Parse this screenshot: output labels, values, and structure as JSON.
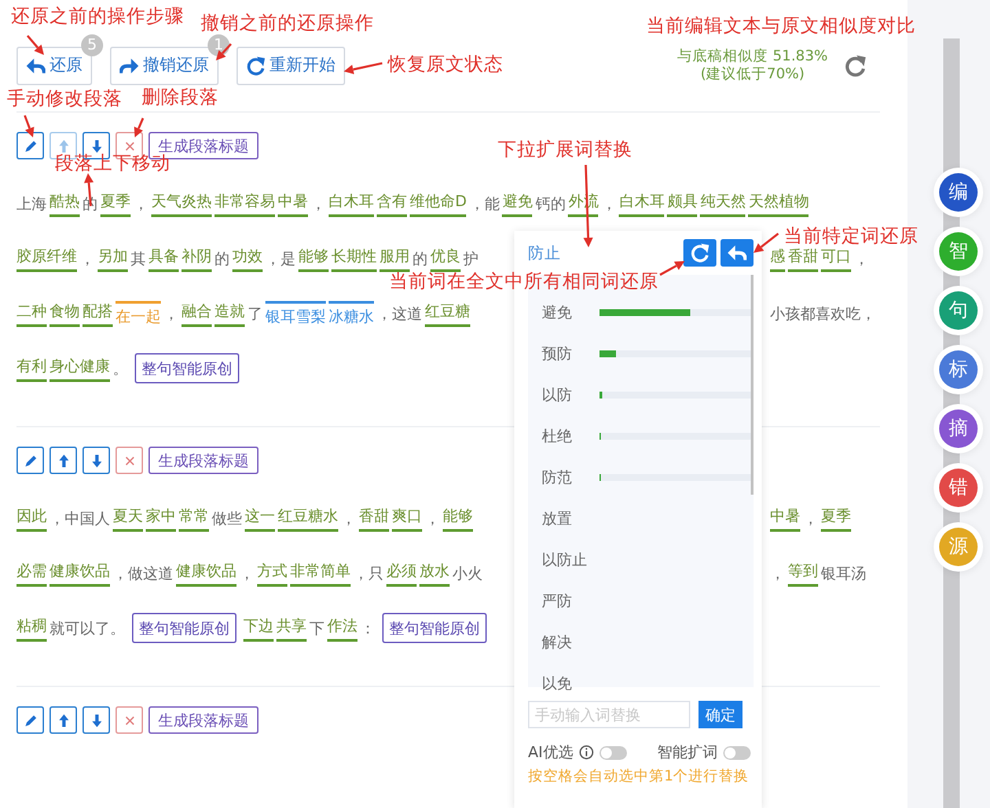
{
  "toolbar": {
    "buttons": [
      {
        "label": "还原",
        "badge": "5"
      },
      {
        "label": "撤销还原",
        "badge": "1"
      },
      {
        "label": "重新开始"
      }
    ],
    "similarity": {
      "value": "与底稿相似度 51.83%",
      "hint": "(建议低于70%)"
    }
  },
  "paragraphs": [
    {
      "title_button": "生成段落标题",
      "up_disabled": true,
      "lines": [
        {
          "left": [
            {
              "text": "上海",
              "kind": "plain"
            },
            {
              "text": "酷热",
              "kind": "word"
            },
            {
              "text": "的",
              "kind": "plain"
            },
            {
              "text": "夏季",
              "kind": "word"
            },
            {
              "text": "，",
              "kind": "plain"
            },
            {
              "text": "天气炎热",
              "kind": "word"
            },
            {
              "text": "非常容易",
              "kind": "word"
            },
            {
              "text": "中暑",
              "kind": "word"
            },
            {
              "text": "，",
              "kind": "plain"
            },
            {
              "text": "白木耳",
              "kind": "word"
            },
            {
              "text": "含有",
              "kind": "word"
            },
            {
              "text": "维他命D",
              "kind": "word"
            },
            {
              "text": "，能",
              "kind": "plain"
            },
            {
              "text": "避免",
              "kind": "word"
            },
            {
              "text": "钙的",
              "kind": "plain"
            },
            {
              "text": "外流",
              "kind": "word"
            },
            {
              "text": "，",
              "kind": "plain"
            },
            {
              "text": "白木耳",
              "kind": "word"
            },
            {
              "text": "颇具",
              "kind": "word"
            },
            {
              "text": "纯天然",
              "kind": "word"
            },
            {
              "text": "天然植物",
              "kind": "word"
            }
          ]
        },
        {
          "left": [
            {
              "text": "胶原纤维",
              "kind": "word"
            },
            {
              "text": "，",
              "kind": "plain"
            },
            {
              "text": "另加",
              "kind": "word"
            },
            {
              "text": "其",
              "kind": "plain"
            },
            {
              "text": "具备",
              "kind": "word"
            },
            {
              "text": "补阴",
              "kind": "word"
            },
            {
              "text": "的",
              "kind": "plain"
            },
            {
              "text": "功效",
              "kind": "word"
            },
            {
              "text": "，是",
              "kind": "plain"
            },
            {
              "text": "能够",
              "kind": "word"
            },
            {
              "text": "长期性",
              "kind": "word"
            },
            {
              "text": "服用",
              "kind": "word"
            },
            {
              "text": "的",
              "kind": "plain"
            },
            {
              "text": "优良",
              "kind": "word"
            },
            {
              "text": "护",
              "kind": "plain"
            }
          ],
          "right": [
            {
              "text": "感",
              "kind": "word"
            },
            {
              "text": "香甜",
              "kind": "word"
            },
            {
              "text": "可口",
              "kind": "word"
            },
            {
              "text": "，",
              "kind": "plain"
            }
          ]
        },
        {
          "left": [
            {
              "text": "二种",
              "kind": "word"
            },
            {
              "text": "食物",
              "kind": "word"
            },
            {
              "text": "配搭",
              "kind": "word"
            },
            {
              "text": "在一起",
              "kind": "changed"
            },
            {
              "text": "，",
              "kind": "plain"
            },
            {
              "text": "融合",
              "kind": "word"
            },
            {
              "text": "造就",
              "kind": "word"
            },
            {
              "text": "了",
              "kind": "plain"
            },
            {
              "text": "银耳雪梨",
              "kind": "linked"
            },
            {
              "text": "冰糖水",
              "kind": "linked"
            },
            {
              "text": "，这道",
              "kind": "plain"
            },
            {
              "text": "红豆糖",
              "kind": "word"
            }
          ],
          "right": [
            {
              "text": "小孩都喜欢吃，",
              "kind": "plain"
            }
          ]
        },
        {
          "left": [
            {
              "text": "有利",
              "kind": "word"
            },
            {
              "text": "身心健康",
              "kind": "word"
            },
            {
              "text": "。",
              "kind": "plain"
            },
            {
              "text": "整句智能原创",
              "kind": "button"
            }
          ]
        }
      ]
    },
    {
      "title_button": "生成段落标题",
      "up_disabled": false,
      "lines": [
        {
          "left": [
            {
              "text": "因此",
              "kind": "word"
            },
            {
              "text": "，中国人",
              "kind": "plain"
            },
            {
              "text": "夏天",
              "kind": "word"
            },
            {
              "text": "家中",
              "kind": "word"
            },
            {
              "text": "常常",
              "kind": "word"
            },
            {
              "text": "做些",
              "kind": "plain"
            },
            {
              "text": "这一",
              "kind": "word"
            },
            {
              "text": "红豆糖水",
              "kind": "word"
            },
            {
              "text": "，",
              "kind": "plain"
            },
            {
              "text": "香甜",
              "kind": "word"
            },
            {
              "text": "爽口",
              "kind": "word"
            },
            {
              "text": "，",
              "kind": "plain"
            },
            {
              "text": "能够",
              "kind": "word"
            }
          ],
          "right": [
            {
              "text": "中暑",
              "kind": "word"
            },
            {
              "text": "，",
              "kind": "plain"
            },
            {
              "text": "夏季",
              "kind": "word"
            }
          ]
        },
        {
          "left": [
            {
              "text": "必需",
              "kind": "word"
            },
            {
              "text": "健康饮品",
              "kind": "word"
            },
            {
              "text": "，做这道",
              "kind": "plain"
            },
            {
              "text": "健康饮品",
              "kind": "word"
            },
            {
              "text": "，",
              "kind": "plain"
            },
            {
              "text": "方式",
              "kind": "word"
            },
            {
              "text": "非常简单",
              "kind": "word"
            },
            {
              "text": "，只",
              "kind": "plain"
            },
            {
              "text": "必须",
              "kind": "word"
            },
            {
              "text": "放水",
              "kind": "word"
            },
            {
              "text": "小火",
              "kind": "plain"
            }
          ],
          "right": [
            {
              "text": "，",
              "kind": "plain"
            },
            {
              "text": "等到",
              "kind": "word"
            },
            {
              "text": "银耳汤",
              "kind": "plain"
            }
          ]
        },
        {
          "left": [
            {
              "text": "粘稠",
              "kind": "word"
            },
            {
              "text": "就可以了。",
              "kind": "plain"
            },
            {
              "text": "整句智能原创",
              "kind": "button"
            },
            {
              "text": "下边",
              "kind": "word"
            },
            {
              "text": "共享",
              "kind": "word"
            },
            {
              "text": "下",
              "kind": "plain"
            },
            {
              "text": "作法",
              "kind": "word"
            },
            {
              "text": "：",
              "kind": "plain"
            },
            {
              "text": "整句智能原创",
              "kind": "button"
            }
          ]
        }
      ]
    },
    {
      "title_button": "生成段落标题",
      "up_disabled": false
    }
  ],
  "popup": {
    "word": "防止",
    "candidates": [
      {
        "word": "避免",
        "level": 0.6
      },
      {
        "word": "预防",
        "level": 0.11
      },
      {
        "word": "以防",
        "level": 0.02
      },
      {
        "word": "杜绝",
        "level": 0.01
      },
      {
        "word": "防范",
        "level": 0.01
      },
      {
        "word": "放置"
      },
      {
        "word": "以防止"
      },
      {
        "word": "严防"
      },
      {
        "word": "解决"
      },
      {
        "word": "以免"
      }
    ],
    "placeholder": "手动输入词替换",
    "confirm": "确定",
    "options": [
      {
        "label": "AI优选",
        "info": true,
        "on": false
      },
      {
        "label": "智能扩词",
        "info": false,
        "on": false
      }
    ],
    "hint": "按空格会自动选中第1个进行替换"
  },
  "side_tools": [
    {
      "label": "编",
      "color": "#2456c6"
    },
    {
      "label": "智",
      "color": "#2eae2e"
    },
    {
      "label": "句",
      "color": "#19a077"
    },
    {
      "label": "标",
      "color": "#4b7ad8"
    },
    {
      "label": "摘",
      "color": "#8857d2"
    },
    {
      "label": "错",
      "color": "#e24a48"
    },
    {
      "label": "源",
      "color": "#e2a823"
    }
  ],
  "annotations": [
    "还原之前的操作步骤",
    "撤销之前的还原操作",
    "当前编辑文本与原文相似度对比",
    "恢复原文状态",
    "手动修改段落",
    "删除段落",
    "下拉扩展词替换",
    "段落上下移动",
    "当前特定词还原",
    "当前词在全文中所有相同词还原"
  ]
}
